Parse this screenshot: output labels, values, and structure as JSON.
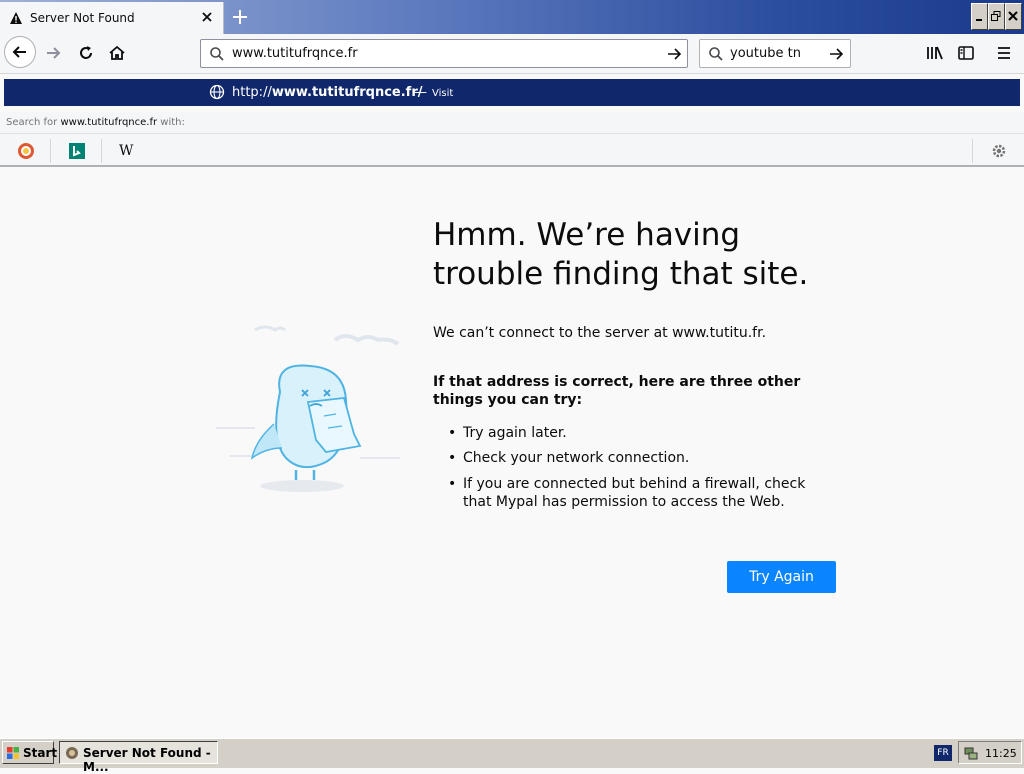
{
  "tab": {
    "title": "Server Not Found",
    "close_icon": "close-icon",
    "warning_icon": "warning-icon"
  },
  "toolbar": {
    "url": "www.tutitufrqnce.fr",
    "search_value": "youtube tn"
  },
  "popup": {
    "url_prefix": "http://",
    "url_bold": "www.tutitufrqnce.fr/",
    "separator": "—",
    "visit": "Visit",
    "search_with_prefix": "Search for ",
    "search_with_term": "www.tutitufrqnce.fr",
    "search_with_suffix": " with:",
    "engines": [
      "duckduckgo",
      "bing",
      "wikipedia"
    ],
    "wiki_letter": "W"
  },
  "content": {
    "heading": "Hmm. We’re having trouble finding that site.",
    "description": "We can’t connect to the server at www.tutitu.fr.",
    "tips_heading": "If that address is correct, here are three other things you can try:",
    "tips": [
      "Try again later.",
      "Check your network connection.",
      "If you are connected but behind a firewall, check that Mypal has permission to access the Web."
    ],
    "button": "Try Again"
  },
  "taskbar": {
    "start": "Start",
    "task": "Server Not Found - M...",
    "lang": "FR",
    "clock": "11:25"
  },
  "colors": {
    "accent": "#0a84ff",
    "popup_bg": "#10286b"
  }
}
